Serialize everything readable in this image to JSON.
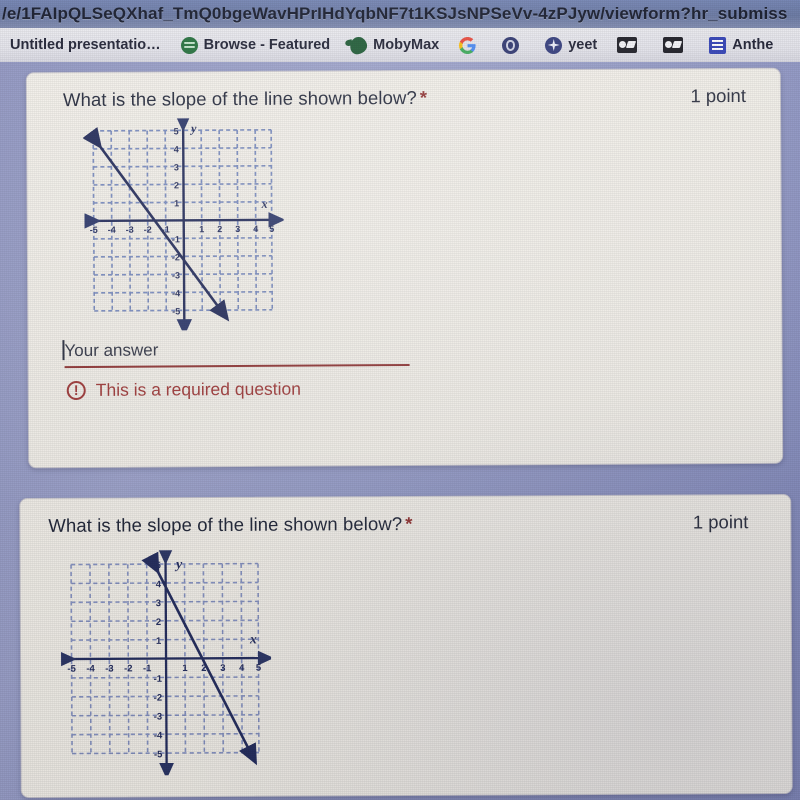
{
  "browser": {
    "url": "/e/1FAIpQLSeQXhaf_TmQ0bgeWavHPrIHdYqbNF7t1KSJsNPSeVv-4zPJyw/viewform?hr_submiss",
    "bookmarks": [
      {
        "label": "Untitled presentatio…",
        "icon": "none"
      },
      {
        "label": "Browse - Featured",
        "icon": "spotify-icon"
      },
      {
        "label": "MobyMax",
        "icon": "mobymax-icon"
      },
      {
        "label": "",
        "icon": "google-icon"
      },
      {
        "label": "",
        "icon": "dark-circle-icon"
      },
      {
        "label": "yeet",
        "icon": "sparkle-circle-icon"
      },
      {
        "label": "",
        "icon": "glasses-icon"
      },
      {
        "label": "",
        "icon": "glasses-icon"
      },
      {
        "label": "Anthe",
        "icon": "blue-document-icon"
      }
    ]
  },
  "colors": {
    "page_background": "#9198c6",
    "card_background": "#f2efe9",
    "required_red": "#8f2d2d",
    "error_red": "#9d3333",
    "graph_ink": "#243066",
    "grid_blue": "#6f7fb8"
  },
  "questions": [
    {
      "title": "What is the slope of the line shown below?",
      "required_marker": "*",
      "points": "1 point",
      "answer_placeholder": "Your answer",
      "answer_value": "",
      "error": "This is a required question",
      "chart_data": {
        "type": "line",
        "title": "",
        "xlabel": "x",
        "ylabel": "y",
        "xlim": [
          -5,
          5
        ],
        "ylim": [
          -5,
          5
        ],
        "xticks": [
          -5,
          -4,
          -3,
          -2,
          -1,
          1,
          2,
          3,
          4,
          5
        ],
        "yticks": [
          5,
          4,
          3,
          2,
          1,
          -1,
          -2,
          -3,
          -4,
          -5
        ],
        "grid": true,
        "grid_style": "dashed",
        "series": [
          {
            "name": "line",
            "points": [
              [
                -5,
                4.5
              ],
              [
                2,
                -5
              ]
            ],
            "slope": -1.357,
            "y_intercept": -1.7,
            "arrows": "both"
          }
        ]
      }
    },
    {
      "title": "What is the slope of the line shown below?",
      "required_marker": "*",
      "points": "1 point",
      "answer_placeholder": "",
      "answer_value": "",
      "error": "",
      "chart_data": {
        "type": "line",
        "title": "",
        "xlabel": "x",
        "ylabel": "y",
        "xlim": [
          -5,
          5
        ],
        "ylim": [
          -5,
          5
        ],
        "xticks": [
          -5,
          -4,
          -3,
          -2,
          -1,
          1,
          2,
          3,
          4,
          5
        ],
        "yticks": [
          5,
          4,
          3,
          2,
          1,
          -1,
          -2,
          -3,
          -4,
          -5
        ],
        "grid": true,
        "grid_style": "dashed",
        "series": [
          {
            "name": "line",
            "points": [
              [
                -0.6,
                5
              ],
              [
                4.5,
                -5
              ]
            ],
            "slope": -2,
            "y_intercept": 3,
            "arrows": "both"
          }
        ]
      }
    }
  ]
}
